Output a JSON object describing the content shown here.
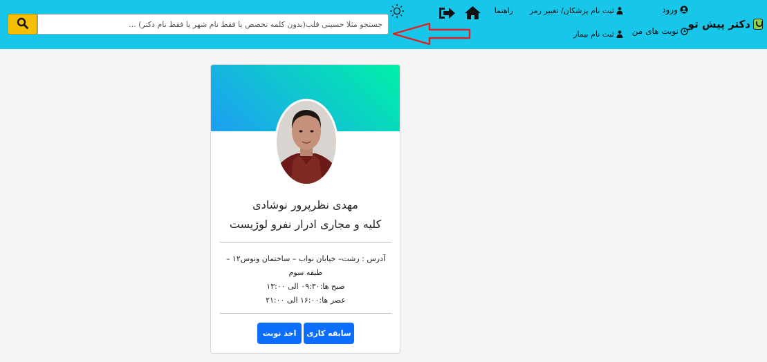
{
  "header": {
    "brand": "دکتر پیش تو",
    "login": "ورود",
    "my_appointments": "نوبت های من",
    "doctor_register": "ثبت نام پزشکان/ تغییر رمز",
    "patient_register": "ثبت نام بیمار",
    "guide": "راهنما",
    "colors": {
      "bar": "#18c6ea",
      "search_button": "#f5c000"
    }
  },
  "search": {
    "placeholder": "جستجو مثلا حسینی قلب(بدون کلمه تخصص یا فقط نام شهر یا فقط نام دکتر) ..."
  },
  "doctor_card": {
    "name": "مهدی نظرپرور نوشادی",
    "specialty": "کلیه و مجاری ادرار نفرو لوژیست",
    "address": "آدرس : رشت– خیابان نواب – ساختمان ونوس۱۲ – طبقه سوم",
    "morning_hours": "صبح ها:۰۹:۳۰ الی ۱۳:۰۰",
    "evening_hours": "عصر ها:۱۶:۰۰ الی ۲۱:۰۰",
    "book_button": "اخذ نوبت",
    "experience_button": "سابقه کاری",
    "colors": {
      "button": "#0d6efd"
    }
  }
}
